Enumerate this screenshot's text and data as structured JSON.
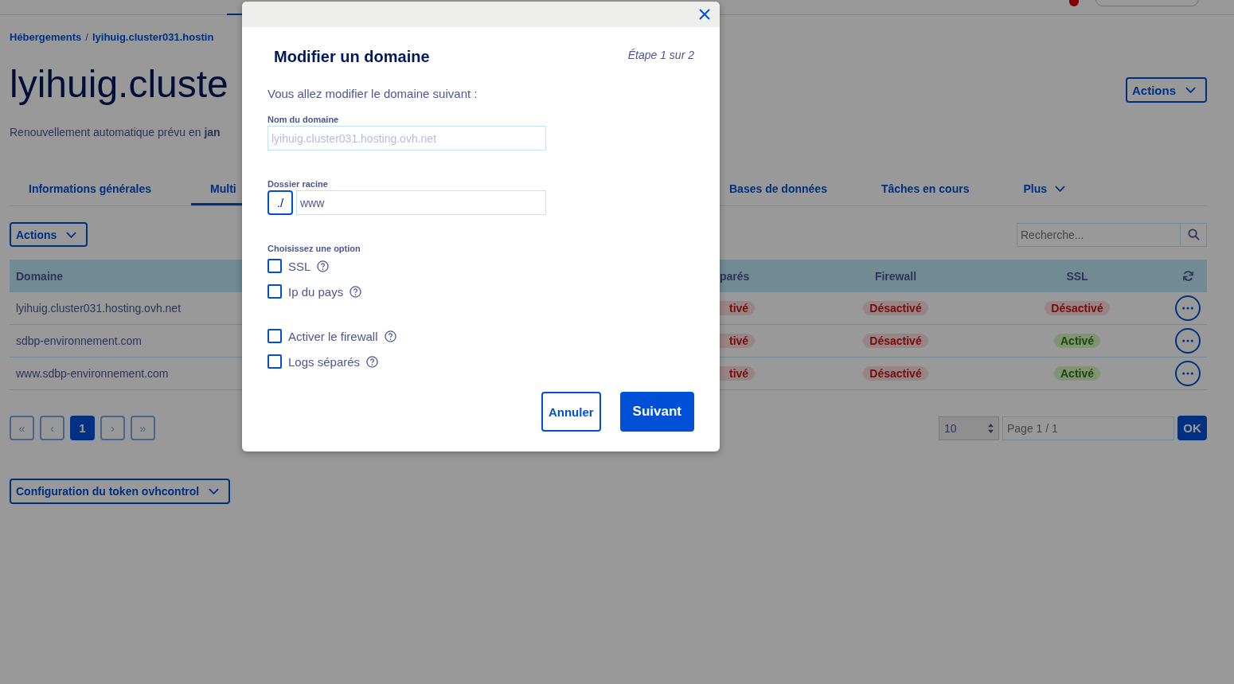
{
  "breadcrumb": {
    "items": [
      "Hébergements",
      "lyihuig.cluster031.hostin"
    ],
    "separator": "/"
  },
  "title": "lyihuig.cluste",
  "renewal": "Renouvellement automatique prévu en **jan**",
  "header_actions": "Actions",
  "tabs": [
    {
      "label": "Informations générales",
      "selected": false,
      "kind": "tab"
    },
    {
      "label": "Multi",
      "selected": true,
      "kind": "tab"
    },
    {
      "label": "Bases de données",
      "selected": false,
      "kind": "tab"
    },
    {
      "label": "Tâches en cours",
      "selected": false,
      "kind": "tab"
    },
    {
      "label": "Plus",
      "selected": false,
      "kind": "menu"
    }
  ],
  "table_actions": "Actions",
  "search": {
    "placeholder": "Recherche..."
  },
  "table": {
    "columns": [
      "Domaine",
      "parés",
      "Firewall",
      "SSL"
    ],
    "rows": [
      {
        "domain": "lyihuig.cluster031.hosting.ovh.net",
        "column_2": {
          "text": "tivé",
          "active": false
        },
        "firewall": {
          "text": "Désactivé",
          "active": false
        },
        "ssl": {
          "text": "Désactivé",
          "active": false
        }
      },
      {
        "domain": "sdbp-environnement.com",
        "column_2": {
          "text": "tivé",
          "active": false
        },
        "firewall": {
          "text": "Désactivé",
          "active": false
        },
        "ssl": {
          "text": "Activé",
          "active": true
        }
      },
      {
        "domain": "www.sdbp-environnement.com",
        "column_2": {
          "text": "tivé",
          "active": false
        },
        "firewall": {
          "text": "Désactivé",
          "active": false
        },
        "ssl": {
          "text": "Activé",
          "active": true
        }
      }
    ]
  },
  "pagination": [
    {
      "label": "«",
      "selected": false
    },
    {
      "label": "‹",
      "selected": false
    },
    {
      "label": "1",
      "selected": true
    },
    {
      "label": "›",
      "selected": false
    },
    {
      "label": "»",
      "selected": false
    }
  ],
  "page_size": "10",
  "page_field": {
    "placeholder": "Page 1 / 1"
  },
  "ok_button": "OK",
  "token_config": "Configuration du token ovhcontrol",
  "modal": {
    "title": "Modifier un domaine",
    "step": "Étape 1 sur 2",
    "intro": "Vous allez modifier le domaine suivant :",
    "domain_field": {
      "label": "Nom du domaine",
      "value": "lyihuig.cluster031.hosting.ovh.net",
      "disabled": true
    },
    "root_field": {
      "label": "Dossier racine",
      "prefix": "./",
      "value": "www"
    },
    "options_label": "Choisissez une option",
    "option_groups": [
      [
        {
          "label": "SSL",
          "checked": false
        },
        {
          "label": "Ip du pays",
          "checked": false
        }
      ],
      [
        {
          "label": "Activer le firewall",
          "checked": false
        },
        {
          "label": "Logs séparés",
          "checked": false
        }
      ]
    ],
    "buttons": [
      {
        "label": "Annuler",
        "kind": "secondary"
      },
      {
        "label": "Suivant",
        "kind": "primary"
      }
    ]
  }
}
